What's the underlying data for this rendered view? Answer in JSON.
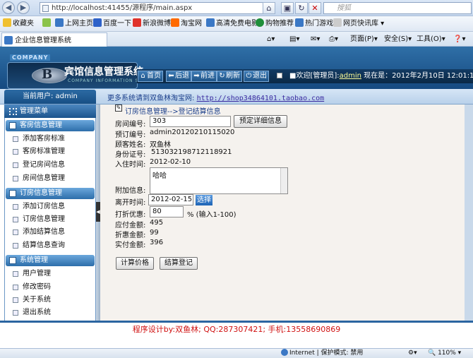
{
  "browser": {
    "url": "http://localhost:41455/源程序/main.aspx",
    "search_placeholder": "搜狐",
    "favorites_label": "收藏夹",
    "fav_links": [
      "上网主页",
      "百度一下",
      "新浪微博",
      "淘宝网",
      "高清免费电影",
      "购物推荐",
      "热门游戏",
      "网页快讯库"
    ],
    "tab_title": "企业信息管理系统",
    "commands": {
      "page": "页面(P)",
      "safety": "安全(S)",
      "tools": "工具(O)"
    }
  },
  "header": {
    "company": "COMPANY",
    "system_name": "宾馆信息管理系统",
    "system_en": "COMPANY INFORMATION SYSTEM",
    "nav": [
      "首页",
      "后退",
      "前进",
      "刷新",
      "退出"
    ],
    "welcome_prefix": "■欢迎[管理员]:",
    "user": "admin",
    "date_text": "现在是：2012年2月10日 12:01:19"
  },
  "strip": {
    "current_user": "当前用户: admin",
    "more_text": "更多系统请到双鱼林淘宝网:",
    "more_link": "http://shop34864101.taobao.com"
  },
  "sidebar": {
    "menu_title": "管理菜单",
    "groups": [
      {
        "title": "客房信息管理",
        "items": [
          "添加客房标准",
          "客房标准管理",
          "登记房间信息",
          "房间信息管理"
        ]
      },
      {
        "title": "订房信息管理",
        "items": [
          "添加订房信息",
          "订房信息管理",
          "添加结算信息",
          "结算信息查询"
        ]
      },
      {
        "title": "系统管理",
        "items": [
          "用户管理",
          "修改密码",
          "关于系统",
          "退出系统"
        ]
      }
    ]
  },
  "form": {
    "breadcrumb": "订房信息管理-->登记结算信息",
    "room_no_label": "房间编号:",
    "room_no_value": "303",
    "detail_button": "预定详细信息",
    "booking_no_label": "预订编号:",
    "booking_no_value": "admin20120210115020",
    "guest_name_label": "顾客姓名:",
    "guest_name_value": "双鱼林",
    "id_card_label": "身份证号:",
    "id_card_value": "513032198712118921",
    "checkin_label": "入住时间:",
    "checkin_value": "2012-02-10",
    "extra_label": "附加信息:",
    "extra_value": "哈哈",
    "checkout_label": "离开时间:",
    "checkout_value": "2012-02-15",
    "select_button": "选择",
    "discount_label": "打折优惠:",
    "discount_value": "80",
    "discount_hint": "% (输入1-100)",
    "due_label": "应付金额:",
    "due_value": "495",
    "discount_amount_label": "折惠金额:",
    "discount_amount_value": "99",
    "paid_label": "实付金额:",
    "paid_value": "396",
    "calc_button": "计算价格",
    "checkout_button": "结算登记"
  },
  "footer": {
    "credit": "程序设计by:双鱼林;  QQ:287307421;  手机:13558690869"
  },
  "status": {
    "zone": "Internet | 保护模式: 禁用",
    "zoom": "110%"
  }
}
